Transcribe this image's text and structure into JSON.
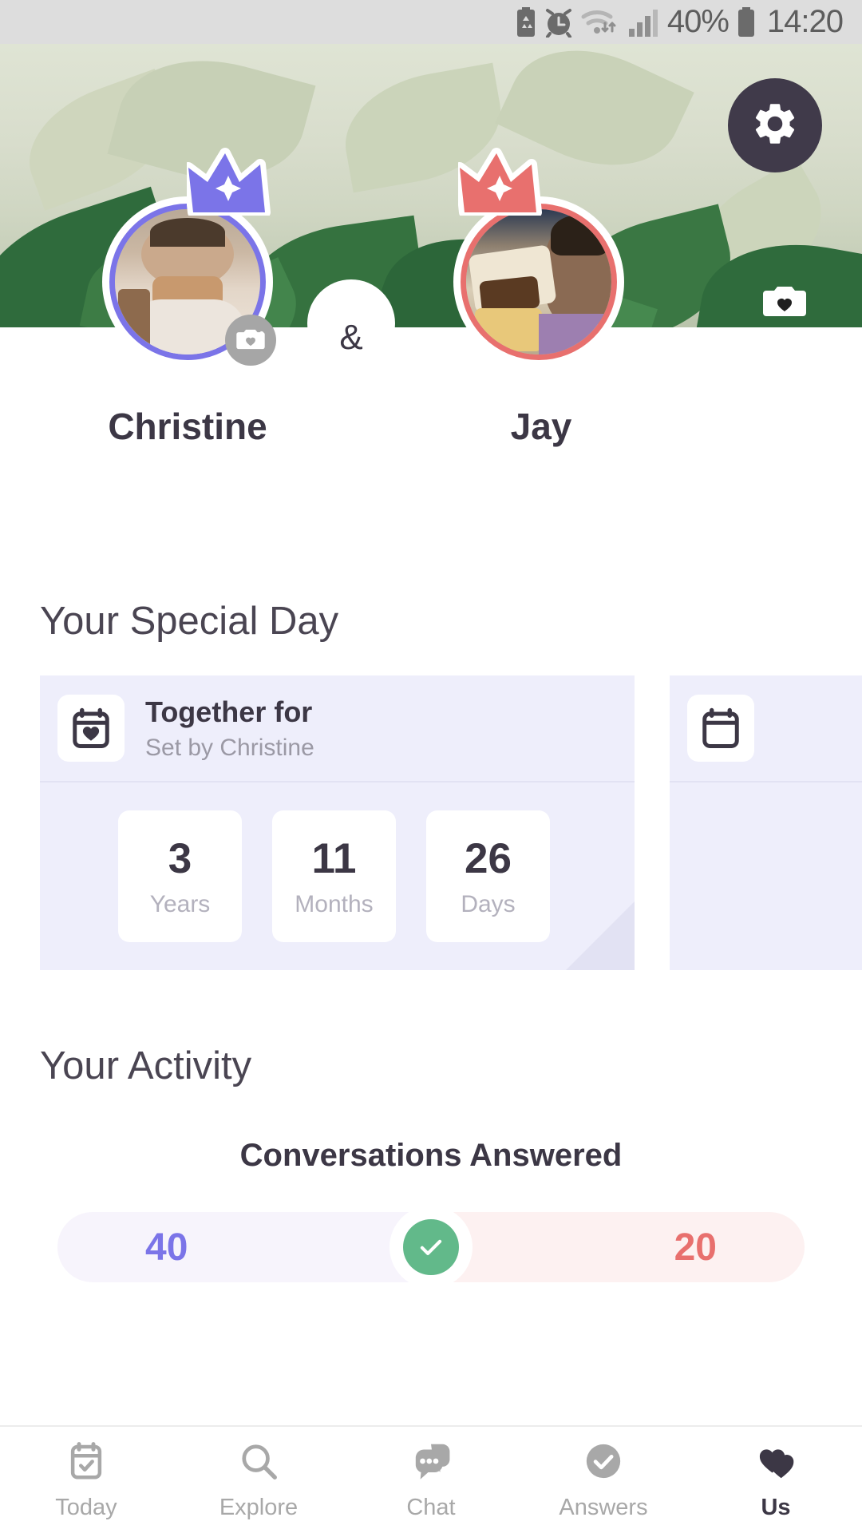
{
  "status_bar": {
    "icons": [
      "battery-saver-icon",
      "alarm-icon",
      "wifi-icon",
      "signal-icon"
    ],
    "battery_percent": "40%",
    "time": "14:20"
  },
  "header": {
    "settings_label": "settings-gear",
    "banner_camera_label": "banner-camera"
  },
  "couple": {
    "ampersand": "&",
    "partners": [
      {
        "name": "Christine",
        "ring_color": "#7b74e8",
        "crown_color": "#7b74e8"
      },
      {
        "name": "Jay",
        "ring_color": "#e8706e",
        "crown_color": "#e8706e"
      }
    ]
  },
  "special_day": {
    "section_title": "Your Special Day",
    "card": {
      "title": "Together for",
      "subtitle": "Set by Christine",
      "icon": "calendar-heart-icon",
      "tiles": [
        {
          "value": "3",
          "label": "Years"
        },
        {
          "value": "11",
          "label": "Months"
        },
        {
          "value": "26",
          "label": "Days"
        }
      ]
    }
  },
  "activity": {
    "section_title": "Your Activity",
    "stat_title": "Conversations Answered",
    "left_value": "40",
    "right_value": "20",
    "left_color": "#7b74e8",
    "right_color": "#e8706e",
    "center_icon": "check-circle-icon"
  },
  "bottom_nav": {
    "items": [
      {
        "label": "Today",
        "icon": "calendar-check-icon",
        "active": false
      },
      {
        "label": "Explore",
        "icon": "search-icon",
        "active": false
      },
      {
        "label": "Chat",
        "icon": "chat-bubbles-icon",
        "active": false
      },
      {
        "label": "Answers",
        "icon": "check-circle-icon",
        "active": false
      },
      {
        "label": "Us",
        "icon": "hearts-icon",
        "active": true
      }
    ]
  }
}
